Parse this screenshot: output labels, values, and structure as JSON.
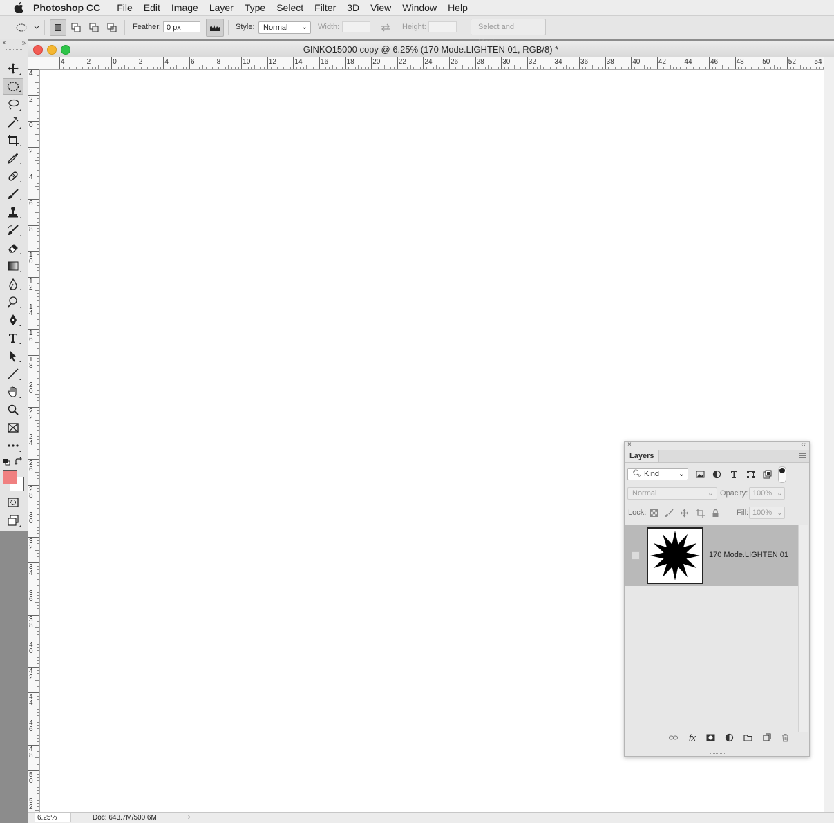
{
  "menubar": {
    "app_name": "Photoshop CC",
    "items": [
      "File",
      "Edit",
      "Image",
      "Layer",
      "Type",
      "Select",
      "Filter",
      "3D",
      "View",
      "Window",
      "Help"
    ]
  },
  "options": {
    "feather_label": "Feather:",
    "feather_value": "0 px",
    "style_label": "Style:",
    "style_value": "Normal",
    "width_label": "Width:",
    "height_label": "Height:",
    "select_mask_label": "Select and Mask..."
  },
  "toolbar": {
    "tools": [
      "move-tool",
      "elliptical-marquee-tool",
      "lasso-tool",
      "magic-wand-tool",
      "crop-tool",
      "eyedropper-tool",
      "healing-brush-tool",
      "brush-tool",
      "clone-stamp-tool",
      "history-brush-tool",
      "eraser-tool",
      "gradient-tool",
      "blur-tool",
      "dodge-tool",
      "pen-tool",
      "type-tool",
      "path-selection-tool",
      "line-tool",
      "hand-tool",
      "zoom-tool",
      "artboard-tool",
      "edit-toolbar"
    ],
    "foreground_color": "#f08080",
    "background_color": "#ffffff"
  },
  "document": {
    "title": "GINKO15000 copy @ 6.25% (170 Mode.LIGHTEN 01, RGB/8) *",
    "h_ruler": [
      "4",
      "2",
      "0",
      "2",
      "4",
      "6",
      "8",
      "10",
      "12",
      "14",
      "16",
      "18",
      "20",
      "22",
      "24",
      "26",
      "28",
      "30",
      "32",
      "34",
      "36",
      "38",
      "40",
      "42",
      "44",
      "46",
      "48",
      "50",
      "52",
      "54"
    ],
    "v_ruler": [
      "4",
      "2",
      "0",
      "2",
      "4",
      "6",
      "8",
      "10",
      "12",
      "14",
      "16",
      "18",
      "20",
      "22",
      "24",
      "26",
      "28",
      "30",
      "32",
      "34",
      "36",
      "38",
      "40",
      "42",
      "44",
      "46",
      "48",
      "50",
      "52"
    ]
  },
  "status": {
    "zoom": "6.25%",
    "doc_size": "Doc: 643.7M/500.6M",
    "arrow": "›"
  },
  "layers_panel": {
    "tab_label": "Layers",
    "filter_kind": "Kind",
    "blend_mode": "Normal",
    "opacity_label": "Opacity:",
    "opacity_value": "100%",
    "lock_label": "Lock:",
    "fill_label": "Fill:",
    "fill_value": "100%",
    "layers": [
      {
        "name": "170 Mode.LIGHTEN 01",
        "selected": true
      }
    ]
  }
}
